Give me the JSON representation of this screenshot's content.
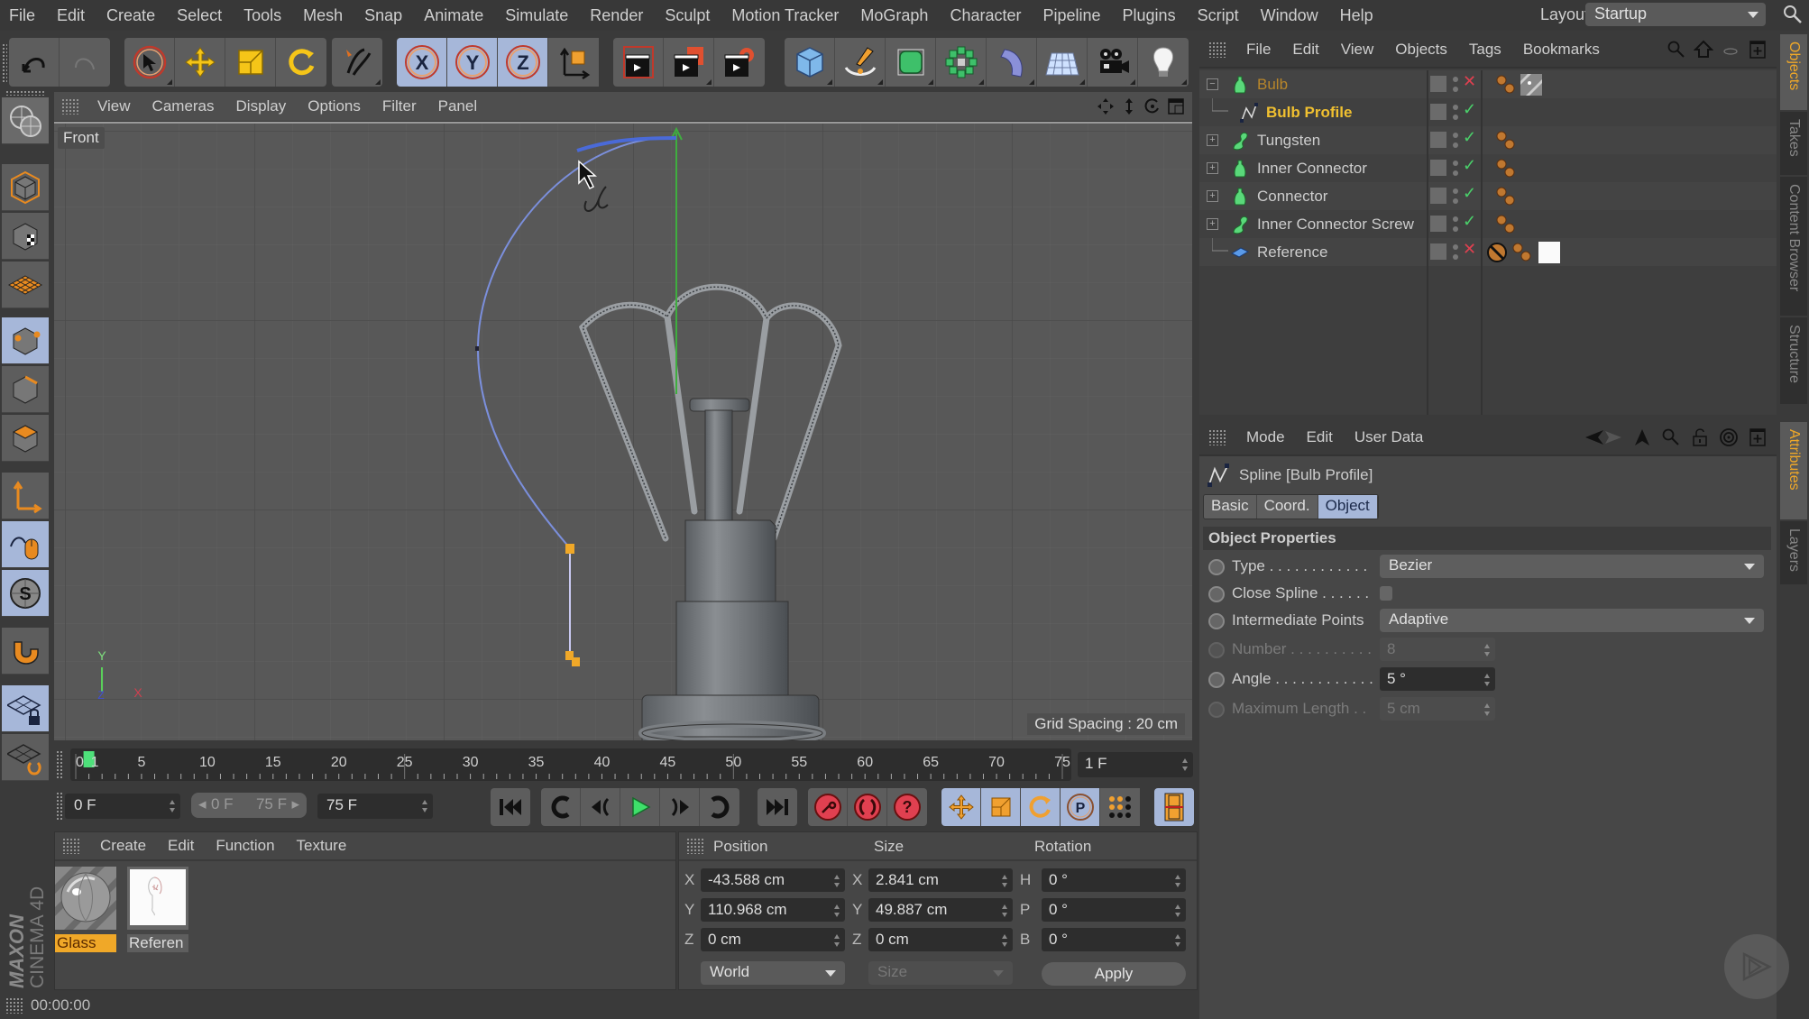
{
  "menubar": {
    "items": [
      "File",
      "Edit",
      "Create",
      "Select",
      "Tools",
      "Mesh",
      "Snap",
      "Animate",
      "Simulate",
      "Render",
      "Sculpt",
      "Motion Tracker",
      "MoGraph",
      "Character",
      "Pipeline",
      "Plugins",
      "Script",
      "Window",
      "Help"
    ],
    "layout_label": "Layout:",
    "layout_value": "Startup"
  },
  "toolbar": {
    "undo": "undo-icon",
    "redo": "redo-icon",
    "axis_x": "X",
    "axis_y": "Y",
    "axis_z": "Z"
  },
  "viewport": {
    "menu": [
      "View",
      "Cameras",
      "Display",
      "Options",
      "Filter",
      "Panel"
    ],
    "view_name": "Front",
    "grid_spacing": "Grid Spacing : 20 cm",
    "axis_y": "Y",
    "axis_x": "X",
    "axis_z": "Z"
  },
  "timeline": {
    "ticks": [
      "0",
      "1",
      "5",
      "10",
      "15",
      "20",
      "25",
      "30",
      "35",
      "40",
      "45",
      "50",
      "55",
      "60",
      "65",
      "70",
      "75"
    ],
    "current_frame": 1,
    "range_start": 0,
    "range_end": 75,
    "frame_field": "1 F"
  },
  "transport": {
    "start_field": "0 F",
    "range_min": "0 F",
    "range_max": "75 F",
    "end_field": "75 F"
  },
  "materials": {
    "menu": [
      "Create",
      "Edit",
      "Function",
      "Texture"
    ],
    "items": [
      {
        "label": "Glass",
        "selected": true
      },
      {
        "label": "Referen",
        "selected": false
      }
    ]
  },
  "coordinates": {
    "headers": {
      "position": "Position",
      "size": "Size",
      "rotation": "Rotation"
    },
    "position": [
      {
        "axis": "X",
        "value": "-43.588 cm"
      },
      {
        "axis": "Y",
        "value": "110.968 cm"
      },
      {
        "axis": "Z",
        "value": "0 cm"
      }
    ],
    "size": [
      {
        "axis": "X",
        "value": "2.841 cm"
      },
      {
        "axis": "Y",
        "value": "49.887 cm"
      },
      {
        "axis": "Z",
        "value": "0 cm"
      }
    ],
    "rotation": [
      {
        "axis": "H",
        "value": "0 °"
      },
      {
        "axis": "P",
        "value": "0 °"
      },
      {
        "axis": "B",
        "value": "0 °"
      }
    ],
    "space_dropdown": "World",
    "size_dropdown": "Size",
    "apply_label": "Apply"
  },
  "statusbar": {
    "time": "00:00:00"
  },
  "logo": {
    "brand": "MAXON",
    "product": "CINEMA 4D"
  },
  "objects": {
    "menu": [
      "File",
      "Edit",
      "View",
      "Objects",
      "Tags",
      "Bookmarks"
    ],
    "rows": [
      {
        "name": "Bulb",
        "icon": "lathe-icon",
        "expander": "−",
        "state": "x",
        "color": "#b8862a"
      },
      {
        "name": "Bulb Profile",
        "icon": "spline-icon",
        "expander": "",
        "state": "check",
        "color": "#f0c030"
      },
      {
        "name": "Tungsten",
        "icon": "sweep-icon",
        "expander": "+",
        "state": "check",
        "color": "#cdcdcd"
      },
      {
        "name": "Inner Connector",
        "icon": "lathe-icon",
        "expander": "+",
        "state": "check",
        "color": "#cdcdcd"
      },
      {
        "name": "Connector",
        "icon": "lathe-icon",
        "expander": "+",
        "state": "check",
        "color": "#cdcdcd"
      },
      {
        "name": "Inner Connector Screw",
        "icon": "sweep-icon",
        "expander": "+",
        "state": "check",
        "color": "#cdcdcd"
      },
      {
        "name": "Reference",
        "icon": "plane-icon",
        "expander": "",
        "state": "x",
        "color": "#cdcdcd"
      }
    ]
  },
  "attributes": {
    "menu": [
      "Mode",
      "Edit",
      "User Data"
    ],
    "title": "Spline [Bulb Profile]",
    "tabs": [
      {
        "label": "Basic",
        "active": false
      },
      {
        "label": "Coord.",
        "active": false
      },
      {
        "label": "Object",
        "active": true
      }
    ],
    "section": "Object Properties",
    "props": {
      "type_label": "Type . . . . . . . . . . . .",
      "type_value": "Bezier",
      "close_label": "Close Spline . . . . . .",
      "close_checked": false,
      "intermediate_label": "Intermediate Points",
      "intermediate_value": "Adaptive",
      "number_label": "Number . . . . . . . . . .",
      "number_value": "8",
      "angle_label": "Angle . . . . . . . . . . . .",
      "angle_value": "5 °",
      "maxlen_label": "Maximum Length . .",
      "maxlen_value": "5 cm"
    }
  },
  "right_tabs": {
    "top": [
      {
        "label": "Objects",
        "active": true
      },
      {
        "label": "Takes",
        "active": false
      },
      {
        "label": "Content Browser",
        "active": false
      },
      {
        "label": "Structure",
        "active": false
      }
    ],
    "bottom": [
      {
        "label": "Attributes",
        "active": true
      },
      {
        "label": "Layers",
        "active": false
      }
    ]
  },
  "colors": {
    "accent_blue": "#a6b7d9",
    "highlight_orange": "#f0a828",
    "spline_blue": "#7b8fdc",
    "axis_green": "#3fae3f"
  }
}
